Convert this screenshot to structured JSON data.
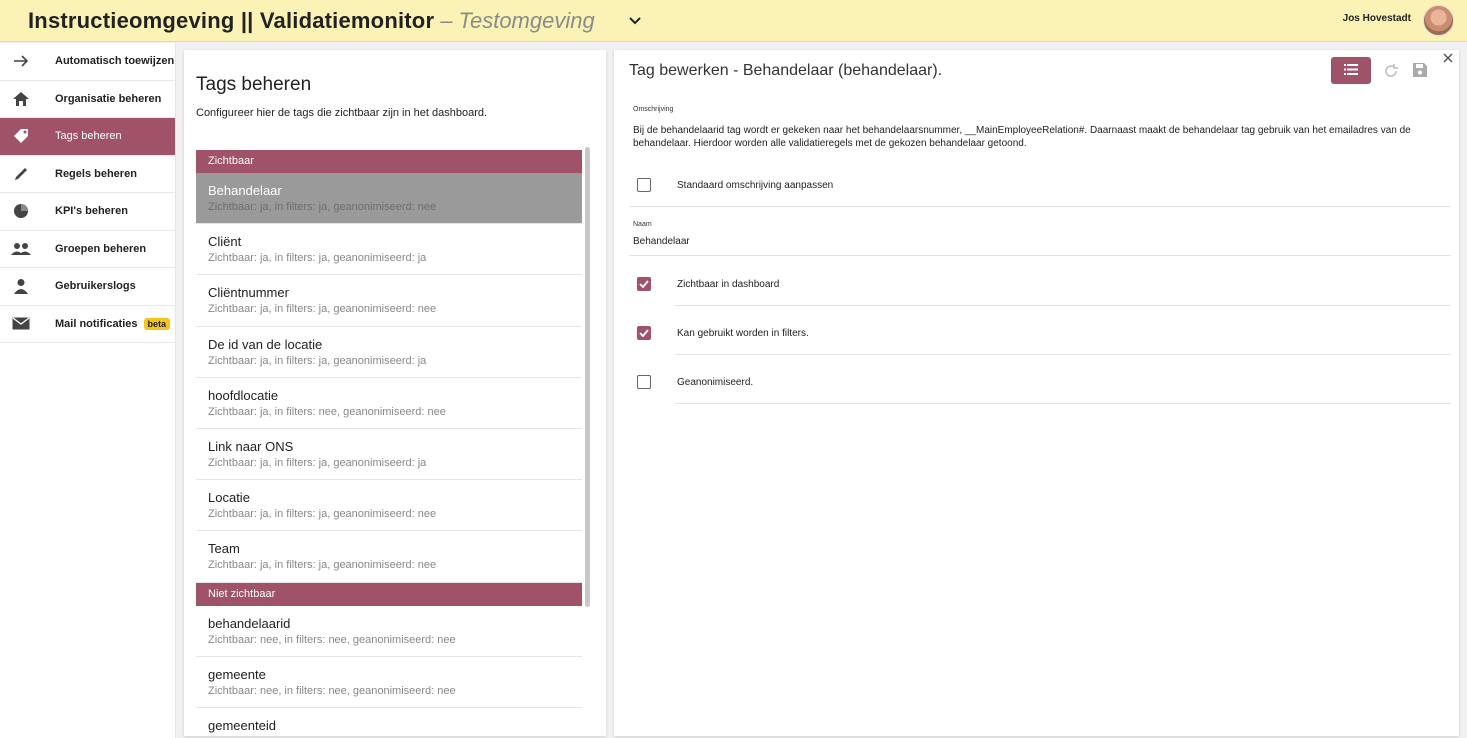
{
  "header": {
    "title": "Instructieomgeving || Validatiemonitor",
    "environment": "– Testomgeving",
    "user_name": "Jos Hovestadt",
    "menu_icon": "chevron-down-icon",
    "background": "#fbf3b6"
  },
  "sidebar": {
    "items": [
      {
        "label": "Automatisch toewijzen",
        "icon": "arrow-right-icon"
      },
      {
        "label": "Organisatie beheren",
        "icon": "home-icon"
      },
      {
        "label": "Tags beheren",
        "icon": "tag-icon",
        "active": true
      },
      {
        "label": "Regels beheren",
        "icon": "pencil-icon"
      },
      {
        "label": "KPI's beheren",
        "icon": "pie-chart-icon"
      },
      {
        "label": "Groepen beheren",
        "icon": "group-icon"
      },
      {
        "label": "Gebruikerslogs",
        "icon": "person-icon"
      },
      {
        "label": "Mail notificaties",
        "icon": "mail-icon",
        "badge": "beta"
      }
    ],
    "accent": "#a05269"
  },
  "tags_panel": {
    "title": "Tags beheren",
    "description": "Configureer hier de tags die zichtbaar zijn in het dashboard.",
    "groups": [
      {
        "header": "Zichtbaar",
        "items": [
          {
            "name": "Behandelaar",
            "sub": "Zichtbaar: ja, in filters: ja, geanonimiseerd: nee",
            "selected": true
          },
          {
            "name": "Cliënt",
            "sub": "Zichtbaar: ja, in filters: ja, geanonimiseerd: ja"
          },
          {
            "name": "Cliëntnummer",
            "sub": "Zichtbaar: ja, in filters: ja, geanonimiseerd: nee"
          },
          {
            "name": "De id van de locatie",
            "sub": "Zichtbaar: ja, in filters: ja, geanonimiseerd: ja"
          },
          {
            "name": "hoofdlocatie",
            "sub": "Zichtbaar: ja, in filters: nee, geanonimiseerd: nee"
          },
          {
            "name": "Link naar ONS",
            "sub": "Zichtbaar: ja, in filters: ja, geanonimiseerd: ja"
          },
          {
            "name": "Locatie",
            "sub": "Zichtbaar: ja, in filters: ja, geanonimiseerd: nee"
          },
          {
            "name": "Team",
            "sub": "Zichtbaar: ja, in filters: ja, geanonimiseerd: nee"
          }
        ]
      },
      {
        "header": "Niet zichtbaar",
        "items": [
          {
            "name": "behandelaarid",
            "sub": "Zichtbaar: nee, in filters: nee, geanonimiseerd: nee"
          },
          {
            "name": "gemeente",
            "sub": "Zichtbaar: nee, in filters: nee, geanonimiseerd: nee"
          },
          {
            "name": "gemeenteid",
            "sub": ""
          }
        ]
      }
    ]
  },
  "edit_panel": {
    "title": "Tag bewerken - Behandelaar (behandelaar).",
    "description_label": "Omschrijving",
    "description_text": "Bij de behandelaarid tag wordt er gekeken naar het behandelaarsnummer, __MainEmployeeRelation#. Daarnaast maakt de behandelaar tag gebruik van het emailadres van de behandelaar. Hierdoor worden alle validatieregels met de gekozen behandelaar getoond.",
    "custom_description": {
      "label": "Standaard omschrijving aanpassen",
      "checked": false
    },
    "name_label": "Naam",
    "name_value": "Behandelaar",
    "visible": {
      "label": "Zichtbaar in dashboard",
      "checked": true
    },
    "filters": {
      "label": "Kan gebruikt worden in filters.",
      "checked": true
    },
    "anonymized": {
      "label": "Geanonimiseerd.",
      "checked": false
    },
    "toolbar_icons": [
      "list-icon",
      "refresh-icon",
      "save-icon",
      "close-icon"
    ]
  }
}
